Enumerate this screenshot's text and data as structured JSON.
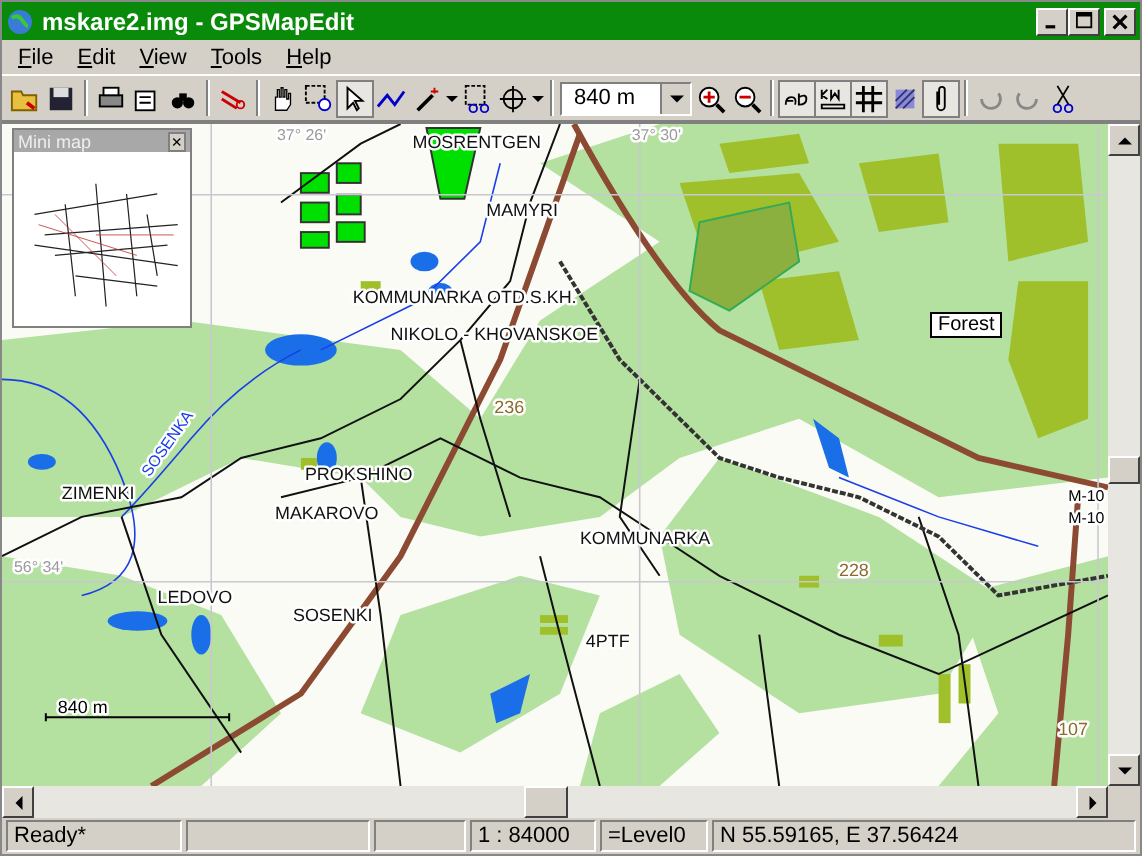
{
  "window": {
    "title": "mskare2.img - GPSMapEdit"
  },
  "menu": [
    {
      "label": "File"
    },
    {
      "label": "Edit"
    },
    {
      "label": "View"
    },
    {
      "label": "Tools"
    },
    {
      "label": "Help"
    }
  ],
  "toolbar": {
    "scale_combo": {
      "value": "840 m"
    }
  },
  "mini_map": {
    "title": "Mini map",
    "close": "×"
  },
  "map": {
    "labels": [
      {
        "kind": "grid",
        "text": "37° 26'"
      },
      {
        "kind": "grid",
        "text": "37° 30'"
      },
      {
        "kind": "grid",
        "text": "56° 34'"
      },
      {
        "kind": "place",
        "text": "MOSRENTGEN"
      },
      {
        "kind": "place",
        "text": "MAMYRI"
      },
      {
        "kind": "place",
        "text": "KOMMUNARKA OTD.S.KH."
      },
      {
        "kind": "place",
        "text": "NIKOLO - KHOVANSKOE"
      },
      {
        "kind": "place",
        "text": "PROKSHINO"
      },
      {
        "kind": "place",
        "text": "ZIMENKI"
      },
      {
        "kind": "place",
        "text": "MAKAROVO"
      },
      {
        "kind": "place",
        "text": "KOMMUNARKA"
      },
      {
        "kind": "place",
        "text": "LEDOVO"
      },
      {
        "kind": "place",
        "text": "SOSENKI"
      },
      {
        "kind": "place",
        "text": "4PTF"
      },
      {
        "kind": "height",
        "text": "236"
      },
      {
        "kind": "height",
        "text": "228"
      },
      {
        "kind": "height",
        "text": "107"
      },
      {
        "kind": "river",
        "text": "SOSENKA"
      },
      {
        "kind": "road",
        "text": "M-10"
      },
      {
        "kind": "road",
        "text": "M-10"
      }
    ],
    "tooltip": "Forest",
    "scale_bar": "840 m"
  },
  "status_bar": {
    "message": "Ready*",
    "scale": "1 : 84000",
    "level": "=Level0",
    "coordinates": "N 55.59165, E 37.56424"
  }
}
